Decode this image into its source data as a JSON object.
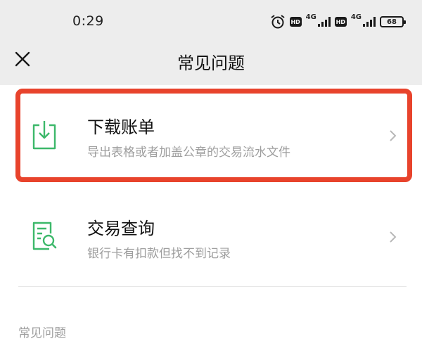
{
  "status_bar": {
    "time": "0:29",
    "hd_badge": "HD",
    "network": "4G",
    "battery": "68"
  },
  "header": {
    "title": "常见问题",
    "close_icon": "close-icon"
  },
  "items": [
    {
      "title": "下载账单",
      "subtitle": "导出表格或者加盖公章的交易流水文件",
      "icon": "download-icon",
      "highlighted": true
    },
    {
      "title": "交易查询",
      "subtitle": "银行卡有扣款但找不到记录",
      "icon": "search-document-icon",
      "highlighted": false
    }
  ],
  "section_header": "常见问题",
  "colors": {
    "accent_green": "#3cb86a",
    "highlight_red": "#e8432c",
    "header_bg": "#ededed"
  }
}
